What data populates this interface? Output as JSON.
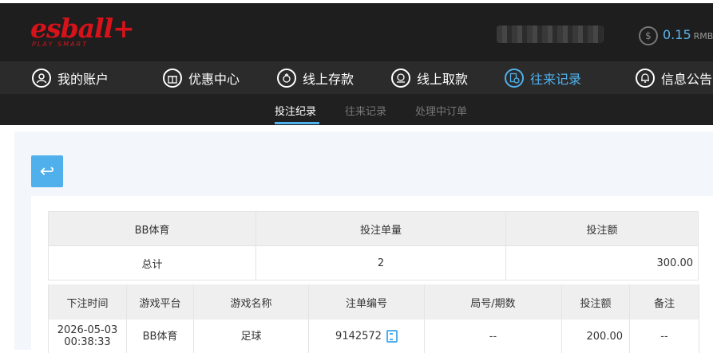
{
  "brand": {
    "logo_text": "esball+",
    "tagline": "PLAY SMART"
  },
  "header": {
    "coin_icon": "$",
    "balance": "0.15",
    "currency": "RMB"
  },
  "nav": [
    {
      "label": "我的账户",
      "icon": "user-icon"
    },
    {
      "label": "优惠中心",
      "icon": "gift-icon"
    },
    {
      "label": "线上存款",
      "icon": "deposit-icon"
    },
    {
      "label": "线上取款",
      "icon": "withdraw-icon"
    },
    {
      "label": "往来记录",
      "icon": "records-icon",
      "active": true
    },
    {
      "label": "信息公告",
      "icon": "bell-icon"
    }
  ],
  "subnav": [
    {
      "label": "投注纪录",
      "active": true
    },
    {
      "label": "往来记录"
    },
    {
      "label": "处理中订单"
    }
  ],
  "back_button": {
    "icon": "↩"
  },
  "summary": {
    "headers": [
      "BB体育",
      "投注单量",
      "投注额"
    ],
    "row": [
      "总计",
      "2",
      "300.00"
    ]
  },
  "details": {
    "headers": [
      "下注时间",
      "游戏平台",
      "游戏名称",
      "注单编号",
      "局号/期数",
      "投注额",
      "备注"
    ],
    "rows": [
      {
        "date": "2026-05-03",
        "time": "00:38:33",
        "platform": "BB体育",
        "game": "足球",
        "order_no": "9142572",
        "round": "--",
        "amount": "200.00",
        "note": "--"
      }
    ]
  },
  "colors": {
    "accent": "#4fb0ec",
    "brand": "#d8121a",
    "header_bg": "#1e1e1e"
  }
}
